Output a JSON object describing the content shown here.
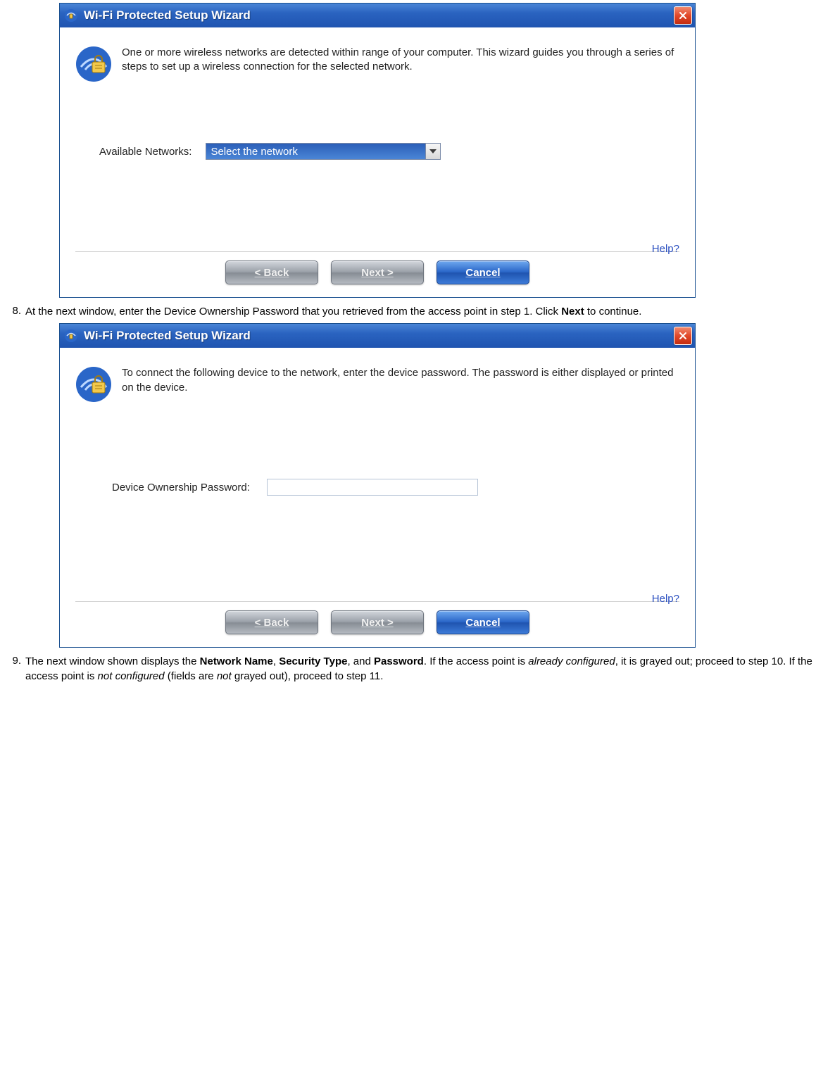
{
  "dialog1": {
    "title": "Wi-Fi Protected Setup Wizard",
    "intro": "One or more wireless networks are detected within range of your computer. This wizard guides you through a series of steps to set up a wireless connection for the selected network.",
    "field_label": "Available Networks:",
    "select_value": "Select the network",
    "help": "Help?",
    "back": "<  Back",
    "next": "Next  >",
    "cancel": "Cancel"
  },
  "step8": {
    "num": "8.",
    "text_before": "At the next window, enter the Device Ownership Password that you retrieved from the access point in step 1. Click ",
    "bold1": "Next",
    "text_after": " to continue."
  },
  "dialog2": {
    "title": "Wi-Fi Protected Setup Wizard",
    "intro": "To connect the following device to the network, enter the device password. The password is either displayed or printed on the device.",
    "field_label": "Device Ownership Password:",
    "input_value": "",
    "help": "Help?",
    "back": "<  Back",
    "next": "Next  >",
    "cancel": "Cancel"
  },
  "step9": {
    "num": "9.",
    "t1": "The next window shown displays the ",
    "b1": "Network Name",
    "t2": ", ",
    "b2": "Security Type",
    "t3": ", and ",
    "b3": "Password",
    "t4": ". If the access point is ",
    "i1": "already configured",
    "t5": ", it is grayed out; proceed to step 10. If the access point is ",
    "i2": "not configured",
    "t6": " (fields are ",
    "i3": "not",
    "t7": " grayed out), proceed to step 11."
  }
}
